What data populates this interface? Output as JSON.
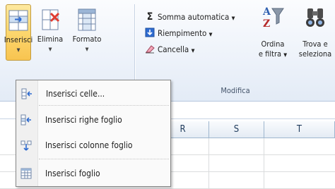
{
  "ribbon": {
    "buttons": {
      "insert": {
        "label": "Inserisci",
        "icon": "insert-cells-icon"
      },
      "delete": {
        "label": "Elimina",
        "icon": "delete-cells-icon"
      },
      "format": {
        "label": "Formato",
        "icon": "format-cells-icon"
      }
    },
    "editing": {
      "autosum": {
        "label": "Somma automatica",
        "icon": "sigma-icon"
      },
      "fill": {
        "label": "Riempimento",
        "icon": "fill-down-icon"
      },
      "clear": {
        "label": "Cancella",
        "icon": "eraser-icon"
      },
      "sort": {
        "label_line1": "Ordina",
        "label_line2": "e filtra",
        "icon": "sort-filter-icon"
      },
      "find": {
        "label_line1": "Trova e",
        "label_line2": "seleziona",
        "icon": "binoculars-icon"
      },
      "group_label": "Modifica"
    }
  },
  "sheet": {
    "columns": [
      "R",
      "S",
      "T"
    ]
  },
  "menu": {
    "items": [
      {
        "label": "Inserisci celle...",
        "icon": "insert-cells-icon"
      },
      {
        "label": "Inserisci righe foglio",
        "icon": "insert-rows-icon"
      },
      {
        "label": "Inserisci colonne foglio",
        "icon": "insert-columns-icon"
      },
      {
        "label": "Inserisci foglio",
        "icon": "insert-sheet-icon"
      }
    ]
  },
  "colors": {
    "accent_active": "#fcd871",
    "ribbon_border": "#b6c7de",
    "insert_icon_red": "#e03c31"
  }
}
